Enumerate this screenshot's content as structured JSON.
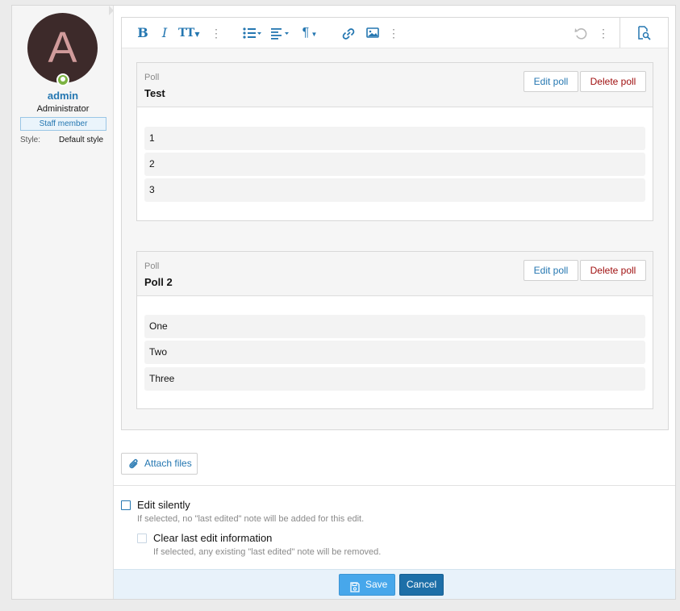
{
  "user": {
    "avatar_letter": "A",
    "name": "admin",
    "title": "Administrator",
    "badge": "Staff member",
    "style_label": "Style:",
    "style_value": "Default style",
    "online_color": "#7cb342"
  },
  "toolbar": {
    "icons": [
      "bold-icon",
      "italic-icon",
      "text-size-icon",
      "more-text-icon",
      "list-icon",
      "align-icon",
      "paragraph-icon",
      "link-icon",
      "image-icon",
      "more-insert-icon",
      "undo-icon",
      "more-options-icon",
      "preview-icon"
    ],
    "bold": "B",
    "italic": "I",
    "text_size": "TT",
    "paragraph": "¶",
    "dots": "⋮"
  },
  "polls": [
    {
      "kind": "Poll",
      "title": "Test",
      "edit_label": "Edit poll",
      "delete_label": "Delete poll",
      "options": [
        "1",
        "2",
        "3"
      ]
    },
    {
      "kind": "Poll",
      "title": "Poll 2",
      "edit_label": "Edit poll",
      "delete_label": "Delete poll",
      "options": [
        "One",
        "Two",
        "Three"
      ]
    }
  ],
  "attach": {
    "label": "Attach files"
  },
  "edit_options": {
    "silent_label": "Edit silently",
    "silent_hint": "If selected, no \"last edited\" note will be added for this edit.",
    "clear_label": "Clear last edit information",
    "clear_hint": "If selected, any existing \"last edited\" note will be removed."
  },
  "footer": {
    "save_label": "Save",
    "cancel_label": "Cancel"
  },
  "colors": {
    "accent": "#2577b1",
    "save": "#47a7eb",
    "cancel": "#1d6fa8",
    "delete": "#a01010"
  }
}
